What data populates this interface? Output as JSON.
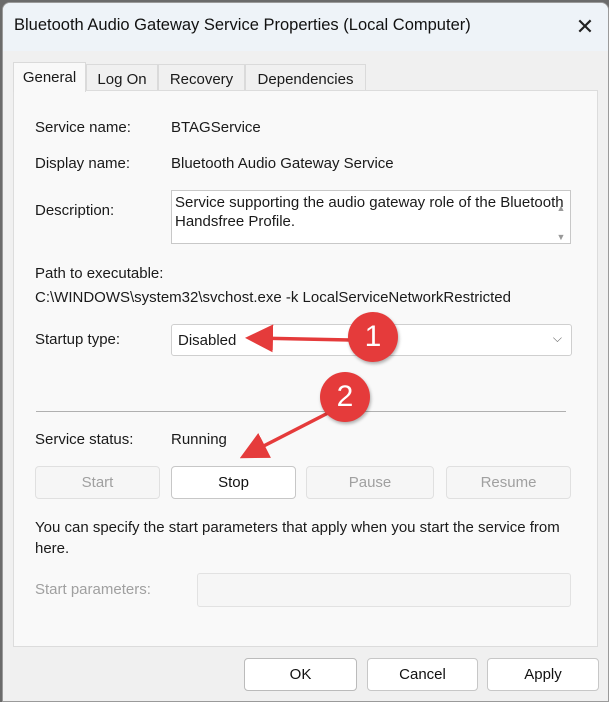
{
  "window": {
    "title": "Bluetooth Audio Gateway Service Properties (Local Computer)",
    "close_icon": "close-icon"
  },
  "tabs": [
    {
      "label": "General",
      "active": true
    },
    {
      "label": "Log On"
    },
    {
      "label": "Recovery"
    },
    {
      "label": "Dependencies"
    }
  ],
  "general": {
    "service_name_label": "Service name:",
    "service_name": "BTAGService",
    "display_name_label": "Display name:",
    "display_name": "Bluetooth Audio Gateway Service",
    "description_label": "Description:",
    "description": "Service supporting the audio gateway role of the Bluetooth Handsfree Profile.",
    "path_label": "Path to executable:",
    "path": "C:\\WINDOWS\\system32\\svchost.exe -k LocalServiceNetworkRestricted",
    "startup_label": "Startup type:",
    "startup_value": "Disabled",
    "status_label": "Service status:",
    "status_value": "Running",
    "buttons": {
      "start": "Start",
      "stop": "Stop",
      "pause": "Pause",
      "resume": "Resume"
    },
    "hint": "You can specify the start parameters that apply when you start the service from here.",
    "params_label": "Start parameters:",
    "params_value": ""
  },
  "footer": {
    "ok": "OK",
    "cancel": "Cancel",
    "apply": "Apply"
  },
  "annotations": {
    "badge1": "1",
    "badge2": "2",
    "color": "#e53b3b"
  }
}
